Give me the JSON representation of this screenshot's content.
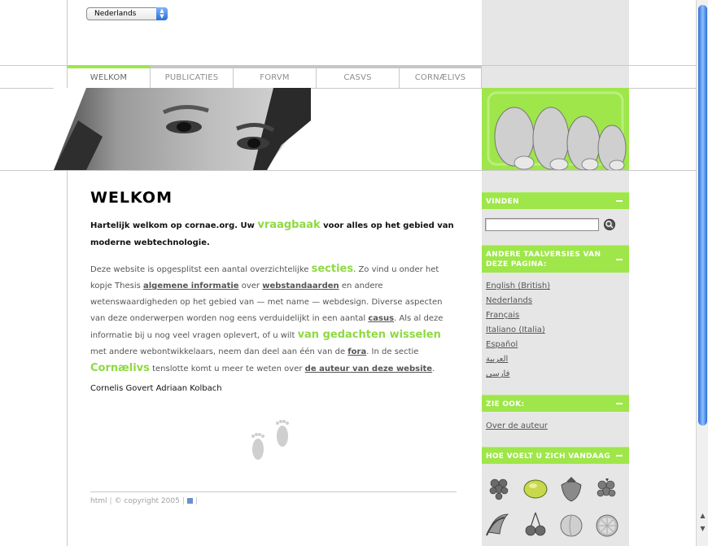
{
  "language_select": {
    "value": "Nederlands"
  },
  "nav": {
    "items": [
      {
        "label": "WELKOM",
        "active": true
      },
      {
        "label": "PUBLICATIES",
        "active": false
      },
      {
        "label": "FORVM",
        "active": false
      },
      {
        "label": "CASVS",
        "active": false
      },
      {
        "label": "CORNÆLIVS",
        "active": false
      }
    ]
  },
  "main": {
    "title": "WELKOM",
    "intro": {
      "p1": "Hartelijk welkom op cornae.org. Uw ",
      "big1": "vraagbaak",
      "p2": " voor alles op het gebied van moderne webtechnologie."
    },
    "body": {
      "t1": "Deze website is opgesplitst een aantal overzichtelijke ",
      "big_secties": "secties",
      "t2": ". Zo vind u onder het kopje Thesis ",
      "link_algemene": "algemene informatie",
      "t3": " over ",
      "link_webstandaarden": "webstandaarden",
      "t4": " en andere wetenswaardigheden op het gebied van — met name — webdesign. Diverse aspecten van deze onderwerpen worden nog eens verduidelijkt in een aantal ",
      "link_casus": "casus",
      "t5": ". Als al deze informatie bij u nog veel vragen oplevert, of u wilt ",
      "big_gedachten": "van gedachten wisselen",
      "t6": " met andere webontwikkelaars, neem dan deel aan één van de ",
      "link_fora": "fora",
      "t7": ". In de sectie ",
      "big_cornaelivs": "Cornælivs",
      "t8": " tenslotte komt u meer te weten over ",
      "link_auteur": "de auteur van deze website",
      "t9": "."
    },
    "signature": "Cornelis Govert Adriaan Kolbach"
  },
  "footer": {
    "html": "html",
    "copyright": "© copyright 2005"
  },
  "sidebar": {
    "vinden": {
      "title": "VINDEN"
    },
    "taal": {
      "title": "ANDERE TAALVERSIES VAN DEZE PAGINA:",
      "links": [
        "English (British)",
        "Nederlands",
        "Français",
        "Italiano (Italia)",
        "Español",
        "العربية",
        "فارسی"
      ]
    },
    "zie_ook": {
      "title": "ZIE OOK:",
      "links": [
        "Over de auteur"
      ]
    },
    "hoe": {
      "title": "HOE VOELT U ZICH VANDAAG"
    }
  },
  "fruits": [
    "grape-icon",
    "lime-icon",
    "strawberry-icon",
    "raspberry-icon",
    "banana-icon",
    "cherry-icon",
    "peach-icon",
    "orange-slice-icon"
  ],
  "colors": {
    "accent": "#9ee64a",
    "sidebar_bg": "#e6e6e6",
    "line": "#c9c9c9"
  }
}
